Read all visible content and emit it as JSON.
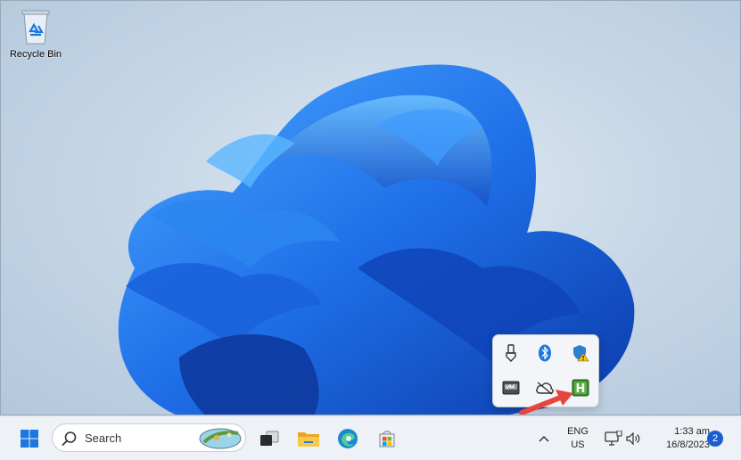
{
  "desktop": {
    "icons": [
      {
        "label": "Recycle Bin",
        "icon": "recycle-bin-icon"
      }
    ]
  },
  "tray_flyout": {
    "icons": [
      "usb-eject-icon",
      "bluetooth-icon",
      "security-warning-icon",
      "vm-icon",
      "cloud-offline-icon",
      "hwmonitor-icon"
    ],
    "highlighted_label": "H"
  },
  "taskbar": {
    "search_placeholder": "Search",
    "pinned": [
      "start-icon",
      "task-view-icon",
      "file-explorer-icon",
      "edge-icon",
      "store-icon"
    ],
    "language": {
      "line1": "ENG",
      "line2": "US"
    },
    "clock": {
      "time": "1:33 am",
      "date": "16/8/2023"
    },
    "notification_count": "2"
  },
  "colors": {
    "accent": "#1a5fd0",
    "arrow": "#e8453c",
    "hw_green": "#3c8a2e"
  }
}
